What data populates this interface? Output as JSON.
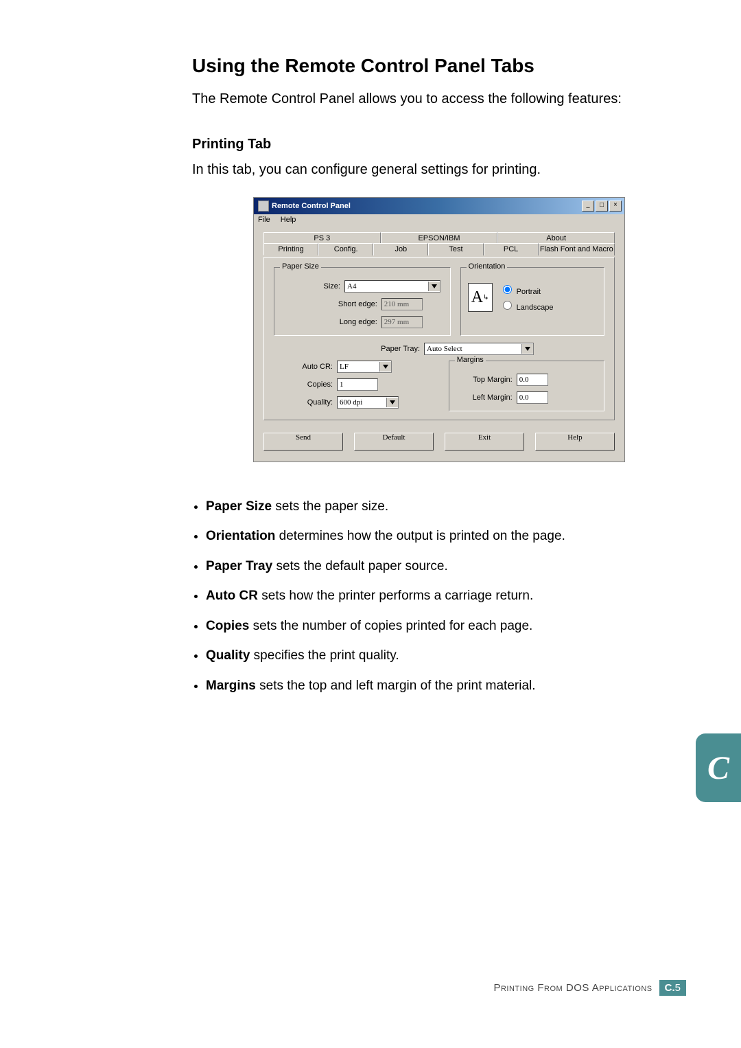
{
  "heading": "Using the Remote Control Panel Tabs",
  "intro": "The Remote Control Panel allows you to access the following features:",
  "section_title": "Printing Tab",
  "section_desc": "In this tab, you can configure general settings for printing.",
  "dialog": {
    "title": "Remote Control Panel",
    "menu": {
      "file": "File",
      "help": "Help"
    },
    "tabs": {
      "top": [
        "PS 3",
        "EPSON/IBM",
        "About"
      ],
      "bottom": [
        "Printing",
        "Config.",
        "Job",
        "Test",
        "PCL",
        "Flash Font and Macro"
      ]
    },
    "paper_size": {
      "legend": "Paper Size",
      "size_label": "Size:",
      "size_value": "A4",
      "short_label": "Short edge:",
      "short_value": "210 mm",
      "long_label": "Long edge:",
      "long_value": "297 mm"
    },
    "orientation": {
      "legend": "Orientation",
      "portrait": "Portrait",
      "landscape": "Landscape"
    },
    "paper_tray": {
      "label": "Paper Tray:",
      "value": "Auto Select"
    },
    "auto_cr": {
      "label": "Auto CR:",
      "value": "LF"
    },
    "copies": {
      "label": "Copies:",
      "value": "1"
    },
    "quality": {
      "label": "Quality:",
      "value": "600 dpi"
    },
    "margins": {
      "legend": "Margins",
      "top_label": "Top Margin:",
      "top_value": "0.0",
      "left_label": "Left Margin:",
      "left_value": "0.0"
    },
    "buttons": {
      "send": "Send",
      "default": "Default",
      "exit": "Exit",
      "help": "Help"
    }
  },
  "bullets": [
    {
      "b": "Paper Size",
      "t": " sets the paper size."
    },
    {
      "b": "Orientation",
      "t": " determines how the output is printed on the page."
    },
    {
      "b": "Paper Tray",
      "t": " sets the default paper source."
    },
    {
      "b": "Auto CR",
      "t": " sets how the printer performs a carriage return."
    },
    {
      "b": "Copies",
      "t": " sets the number of copies printed for each page."
    },
    {
      "b": "Quality",
      "t": " specifies the print quality."
    },
    {
      "b": "Margins",
      "t": " sets the top and left margin of the print material."
    }
  ],
  "side_tab": "C",
  "footer": {
    "text": "Printing From DOS Applications",
    "chapter": "C.",
    "page": "5"
  }
}
